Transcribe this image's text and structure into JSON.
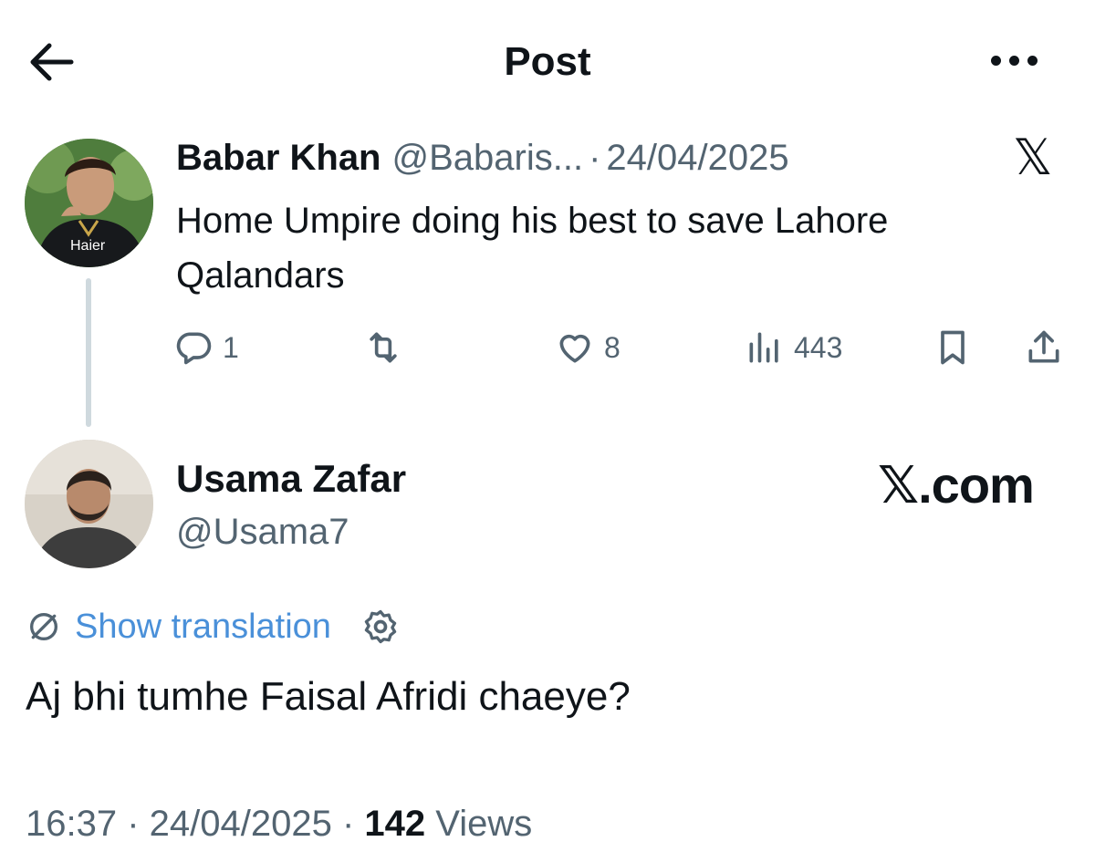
{
  "header": {
    "title": "Post",
    "back_icon": "arrow-left-icon",
    "more_icon": "more-dots-icon"
  },
  "quoted_post": {
    "author_name": "Babar Khan",
    "author_handle": "@Babaris...",
    "separator": "·",
    "date": "24/04/2025",
    "text": "Home Umpire doing his best to save Lahore Qalandars",
    "platform_logo": "𝕏",
    "avatar_shirt_text": "Haier",
    "actions": {
      "replies": "1",
      "retweets": "",
      "likes": "8",
      "views": "443"
    }
  },
  "reply": {
    "author_name": "Usama Zafar",
    "author_handle": "@Usama7",
    "watermark": "𝕏.com",
    "show_translation": "Show translation",
    "text": "Aj bhi tumhe Faisal Afridi chaeye?",
    "time": "16:37",
    "separator": " · ",
    "date": "24/04/2025",
    "views_count": "142",
    "views_label": "Views"
  },
  "colors": {
    "text": "#0f1419",
    "muted": "#536471",
    "link": "#4a90d9",
    "thread_line": "#cfd9de"
  }
}
